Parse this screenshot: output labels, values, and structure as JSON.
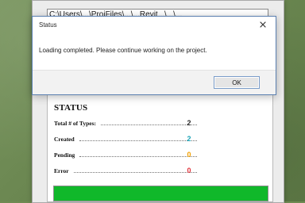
{
  "background": {
    "color": "#6f8a52"
  },
  "main_window": {
    "path_text": "C:\\Users\\...\\ProjFiles\\...\\...Revit...\\...\\..."
  },
  "dialog": {
    "title": "Status",
    "message": "Loading completed. Please continue working on the project.",
    "ok_label": "OK",
    "close_icon": "close-icon"
  },
  "status": {
    "heading": "STATUS",
    "rows": [
      {
        "label": "Total # of Types:",
        "value": "2",
        "color": "#2b2b2b"
      },
      {
        "label": "Created",
        "value": "2",
        "color": "#1aa3b6"
      },
      {
        "label": "Pending",
        "value": "0",
        "color": "#f2a000"
      },
      {
        "label": "Error",
        "value": "0",
        "color": "#e1323a"
      }
    ],
    "progress": 1
  },
  "colors": {
    "progress_fill": "#10b82a",
    "dialog_border": "#5a7fb0",
    "window_bg": "#ececec"
  }
}
